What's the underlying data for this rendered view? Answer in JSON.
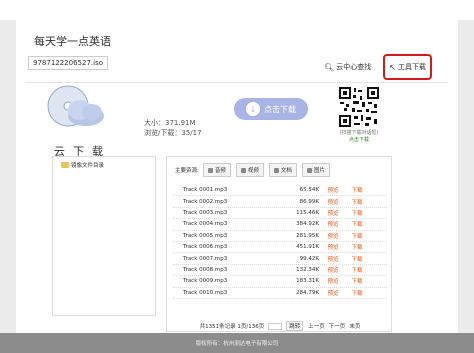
{
  "header": {
    "site_title": "每天学一点英语",
    "file_name": "9787122206527.iso",
    "search_label": "云中心查找",
    "tool_download_label": "工具下载"
  },
  "resource": {
    "cloud_text": "云下载",
    "size_text": "大小：371.91M",
    "views_text": "浏览/下载：35/17",
    "download_button_label": "点击下载"
  },
  "qr": {
    "caption_line1": "(扫描下载对话框)",
    "caption_line2": "点击下载"
  },
  "tree": {
    "root_label": "镜像文件目录"
  },
  "types": {
    "label": "主要资源:",
    "tabs": [
      "音频",
      "视频",
      "文档",
      "图片"
    ]
  },
  "tracks": [
    {
      "name": "Track 0001.mp3",
      "size": "65.54K",
      "preview": "预览",
      "download": "下载"
    },
    {
      "name": "Track 0002.mp3",
      "size": "86.99K",
      "preview": "预览",
      "download": "下载"
    },
    {
      "name": "Track 0003.mp3",
      "size": "115.46K",
      "preview": "预览",
      "download": "下载"
    },
    {
      "name": "Track 0004.mp3",
      "size": "384.92K",
      "preview": "预览",
      "download": "下载"
    },
    {
      "name": "Track 0005.mp3",
      "size": "281.95K",
      "preview": "预览",
      "download": "下载"
    },
    {
      "name": "Track 0006.mp3",
      "size": "451.91K",
      "preview": "预览",
      "download": "下载"
    },
    {
      "name": "Track 0007.mp3",
      "size": "99.42K",
      "preview": "预览",
      "download": "下载"
    },
    {
      "name": "Track 0008.mp3",
      "size": "132.34K",
      "preview": "预览",
      "download": "下载"
    },
    {
      "name": "Track 0009.mp3",
      "size": "183.31K",
      "preview": "预览",
      "download": "下载"
    },
    {
      "name": "Track 0010.mp3",
      "size": "284.79K",
      "preview": "预览",
      "download": "下载"
    }
  ],
  "pager": {
    "summary": "共1351条记录 1页/136页",
    "page_value": "",
    "go_label": "跳转",
    "prev": "上一页",
    "next": "下一页",
    "last": "末页"
  },
  "footer": {
    "text": "版权所有：杭州测达电子有限公司"
  },
  "colors": {
    "highlight_border": "#d01c1c",
    "download_button": "#a9b4e6",
    "link_orange": "#e05a1a",
    "footer_bg": "#8c8c8c"
  }
}
